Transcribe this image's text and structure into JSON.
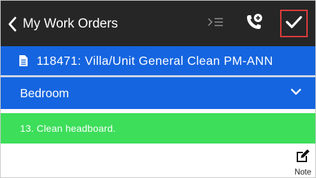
{
  "header": {
    "back_label": "My Work Orders",
    "back_icon": "chevron-left-icon",
    "collapse_icon": "collapse-list-icon",
    "phone_icon": "phone-add-icon",
    "complete_icon": "checkmark-icon",
    "background": "#262626",
    "highlight_color": "#e03c3c"
  },
  "work_order": {
    "title": "118471: Villa/Unit General Clean PM-ANN",
    "icon": "document-icon",
    "color": "#1565e0"
  },
  "section": {
    "label": "Bedroom",
    "icon": "chevron-down-icon",
    "expanded": true
  },
  "task": {
    "label": "13. Clean headboard.",
    "status_color": "#3dde5a"
  },
  "note": {
    "label": "Note",
    "icon": "edit-note-icon"
  }
}
